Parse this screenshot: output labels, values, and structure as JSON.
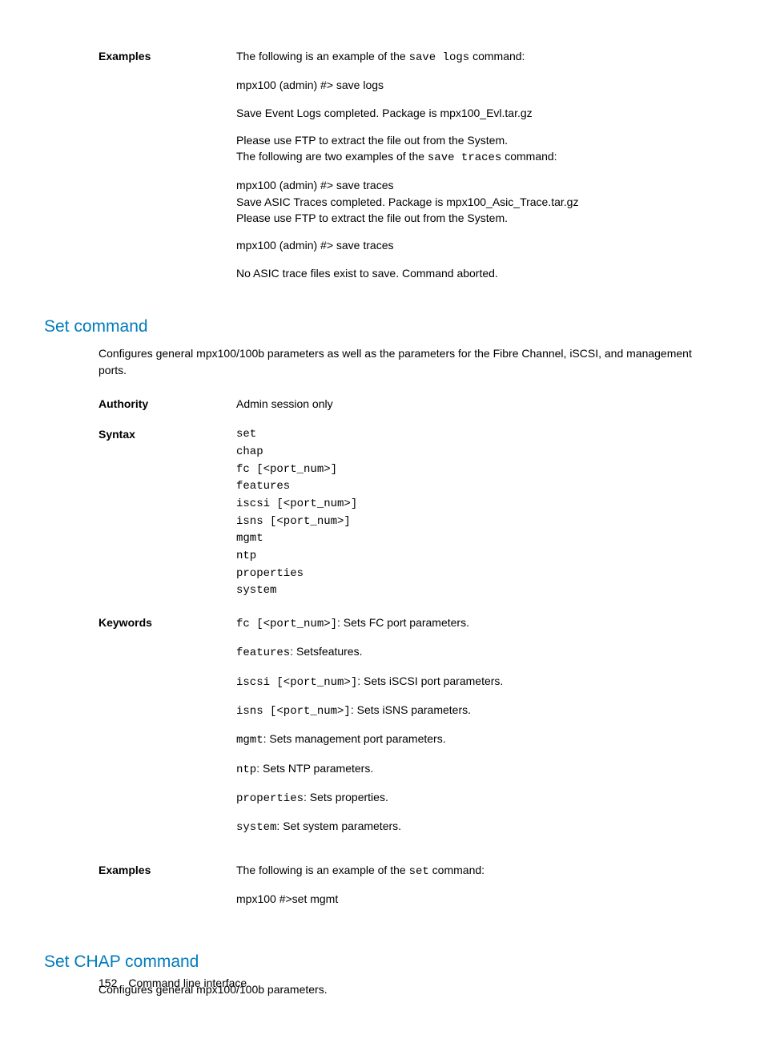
{
  "sec1": {
    "label": "Examples",
    "intro_pre": "The following is an example of the ",
    "intro_code": "save logs",
    "intro_post": " command:",
    "line1": "mpx100 (admin) #> save logs",
    "line2": "Save Event Logs completed. Package is mpx100_Evl.tar.gz",
    "line3": "Please use FTP to extract the file out from the System.",
    "line4_pre": "The following are two examples of the ",
    "line4_code": "save traces",
    "line4_post": " command:",
    "line5": "mpx100 (admin) #> save traces",
    "line6": "Save ASIC Traces completed. Package is mpx100_Asic_Trace.tar.gz",
    "line7": "Please use FTP to extract the file out from the System.",
    "line8": "mpx100 (admin) #> save traces",
    "line9": "No ASIC trace files exist to save. Command aborted."
  },
  "set": {
    "title": "Set command",
    "intro": "Configures general mpx100/100b parameters as well as the parameters for the Fibre Channel, iSCSI, and management ports.",
    "authority": {
      "label": "Authority",
      "value": "Admin session only"
    },
    "syntax": {
      "label": "Syntax",
      "block": "set\nchap\nfc [<port_num>]\nfeatures\niscsi [<port_num>]\nisns [<port_num>]\nmgmt\nntp\nproperties\nsystem"
    },
    "keywords": {
      "label": "Keywords",
      "items": [
        {
          "code": "fc [<port_num>]",
          "desc": ": Sets FC port parameters."
        },
        {
          "code": "features",
          "desc": ": Setsfeatures."
        },
        {
          "code": "iscsi [<port_num>]",
          "desc": ": Sets iSCSI port parameters."
        },
        {
          "code": "isns [<port_num>]",
          "desc": ": Sets iSNS parameters."
        },
        {
          "code": "mgmt",
          "desc": ": Sets management port parameters."
        },
        {
          "code": "ntp",
          "desc": ": Sets NTP parameters."
        },
        {
          "code": "properties",
          "desc": ": Sets properties."
        },
        {
          "code": "system",
          "desc": ": Set system parameters."
        }
      ]
    },
    "examples": {
      "label": "Examples",
      "intro_pre": "The following is an example of the ",
      "intro_code": "set",
      "intro_post": " command:",
      "line1": "mpx100 #>set mgmt"
    }
  },
  "chap": {
    "title": "Set CHAP command",
    "intro": "Configures general mpx100/100b parameters."
  },
  "footer": {
    "page": "152",
    "label": "Command line interface"
  }
}
